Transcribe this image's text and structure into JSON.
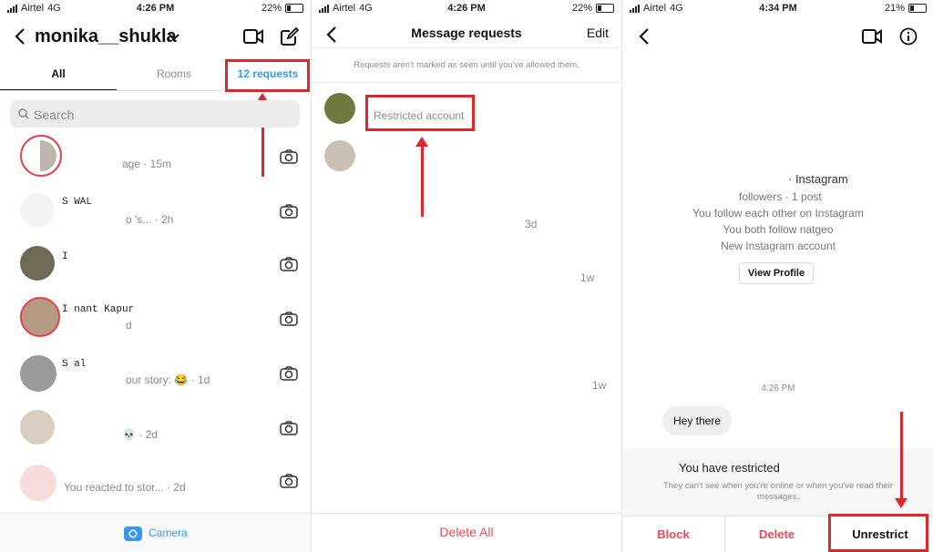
{
  "status_left": {
    "carrier": "Airtel",
    "network": "4G",
    "time": "4:26 PM",
    "battery": "22%"
  },
  "status_mid": {
    "carrier": "Airtel",
    "network": "4G",
    "time": "4:26 PM",
    "battery": "22%"
  },
  "status_right": {
    "carrier": "Airtel",
    "network": "4G",
    "time": "4:34 PM",
    "battery": "21%"
  },
  "inbox": {
    "username": "monika__shukla",
    "tabs": {
      "all": "All",
      "rooms": "Rooms",
      "requests": "12 requests"
    },
    "search_placeholder": "Search",
    "rows": [
      {
        "name": "",
        "preview": "age · 15m"
      },
      {
        "name": "S          WAL",
        "preview": "o                       's... · 2h"
      },
      {
        "name": "I",
        "preview": ""
      },
      {
        "name": "I             nant Kapur",
        "preview": "d"
      },
      {
        "name": "S             al",
        "preview": "our story: 😂 · 1d"
      },
      {
        "name": "",
        "preview": "💀 · 2d"
      },
      {
        "name": "",
        "preview": "You reacted to                    stor... · 2d"
      }
    ],
    "camera_label": "Camera"
  },
  "requests": {
    "title": "Message requests",
    "edit": "Edit",
    "notice": "Requests aren't marked as seen until you've allowed them.",
    "restricted_label": "Restricted account",
    "times": [
      "3d",
      "1w",
      "1w"
    ],
    "delete_all": "Delete All"
  },
  "chat": {
    "profile_line": "· Instagram",
    "followers": "followers · 1 post",
    "follow_each_other": "You follow each other on Instagram",
    "both_follow": "You both follow natgeo",
    "new_account": "New Instagram account",
    "view_profile": "View Profile",
    "timestamp": "4:26 PM",
    "message": "Hey there",
    "restricted_title": "You have restricted",
    "restricted_sub": "They can't see when you're online or when you've read their messages.",
    "block": "Block",
    "delete": "Delete",
    "unrestrict": "Unrestrict"
  },
  "colors": {
    "accent_blue": "#3897f0",
    "annotation_red": "#e0262b",
    "danger": "#ed4956"
  }
}
